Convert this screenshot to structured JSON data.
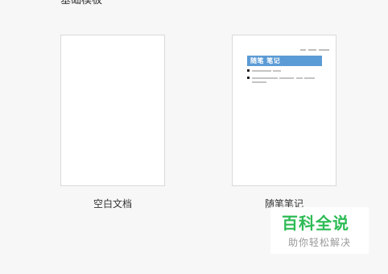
{
  "section": {
    "title": "基础模板"
  },
  "templates": [
    {
      "label": "空白文档"
    },
    {
      "label": "随笔笔记",
      "thumbnail_title": "随笔 笔记",
      "accent_color": "#5b9bd5"
    }
  ],
  "watermark": {
    "title": "百科全说",
    "subtitle": "助你轻松解决",
    "color": "#2dbb55"
  }
}
